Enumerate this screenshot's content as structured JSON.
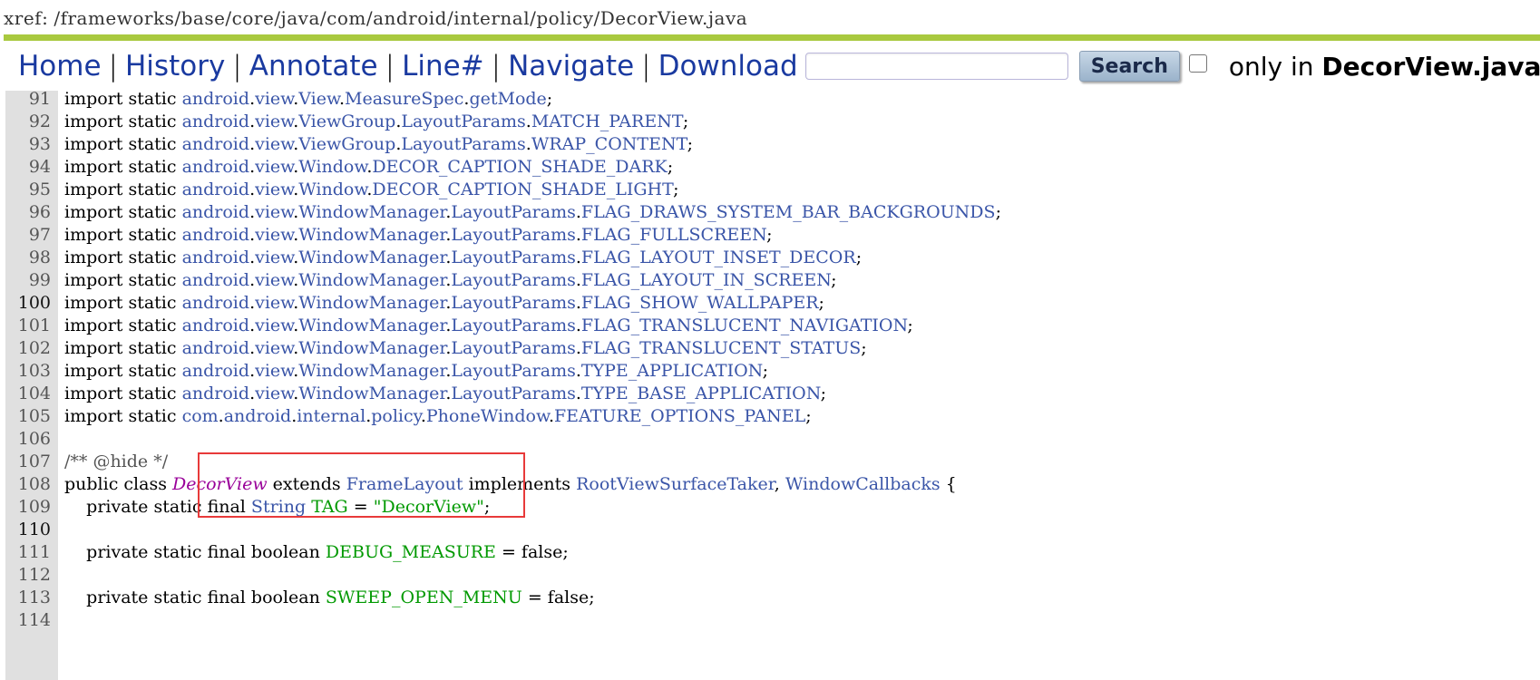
{
  "xref": {
    "label": "xref:",
    "path": "/frameworks/base/core/java/com/android/internal/policy/DecorView.java"
  },
  "nav": {
    "home": "Home",
    "history": "History",
    "annotate": "Annotate",
    "line": "Line#",
    "navigate": "Navigate",
    "download": "Download",
    "separator": "|",
    "search_button": "Search",
    "search_value": "",
    "only_in_prefix": "only in",
    "only_in_file": "DecorView.java"
  },
  "code_lines": [
    {
      "num": "91",
      "tokens": [
        {
          "t": "import static ",
          "c": "kw"
        },
        {
          "t": "android",
          "c": "pkg"
        },
        {
          "t": ".",
          "c": "punct"
        },
        {
          "t": "view",
          "c": "pkg"
        },
        {
          "t": ".",
          "c": "punct"
        },
        {
          "t": "View",
          "c": "cls"
        },
        {
          "t": ".",
          "c": "punct"
        },
        {
          "t": "MeasureSpec",
          "c": "cls"
        },
        {
          "t": ".",
          "c": "punct"
        },
        {
          "t": "getMode",
          "c": "cls"
        },
        {
          "t": ";",
          "c": "punct"
        }
      ]
    },
    {
      "num": "92",
      "tokens": [
        {
          "t": "import static ",
          "c": "kw"
        },
        {
          "t": "android",
          "c": "pkg"
        },
        {
          "t": ".",
          "c": "punct"
        },
        {
          "t": "view",
          "c": "pkg"
        },
        {
          "t": ".",
          "c": "punct"
        },
        {
          "t": "ViewGroup",
          "c": "cls"
        },
        {
          "t": ".",
          "c": "punct"
        },
        {
          "t": "LayoutParams",
          "c": "cls"
        },
        {
          "t": ".",
          "c": "punct"
        },
        {
          "t": "MATCH_PARENT",
          "c": "cls"
        },
        {
          "t": ";",
          "c": "punct"
        }
      ]
    },
    {
      "num": "93",
      "tokens": [
        {
          "t": "import static ",
          "c": "kw"
        },
        {
          "t": "android",
          "c": "pkg"
        },
        {
          "t": ".",
          "c": "punct"
        },
        {
          "t": "view",
          "c": "pkg"
        },
        {
          "t": ".",
          "c": "punct"
        },
        {
          "t": "ViewGroup",
          "c": "cls"
        },
        {
          "t": ".",
          "c": "punct"
        },
        {
          "t": "LayoutParams",
          "c": "cls"
        },
        {
          "t": ".",
          "c": "punct"
        },
        {
          "t": "WRAP_CONTENT",
          "c": "cls"
        },
        {
          "t": ";",
          "c": "punct"
        }
      ]
    },
    {
      "num": "94",
      "tokens": [
        {
          "t": "import static ",
          "c": "kw"
        },
        {
          "t": "android",
          "c": "pkg"
        },
        {
          "t": ".",
          "c": "punct"
        },
        {
          "t": "view",
          "c": "pkg"
        },
        {
          "t": ".",
          "c": "punct"
        },
        {
          "t": "Window",
          "c": "cls"
        },
        {
          "t": ".",
          "c": "punct"
        },
        {
          "t": "DECOR_CAPTION_SHADE_DARK",
          "c": "cls"
        },
        {
          "t": ";",
          "c": "punct"
        }
      ]
    },
    {
      "num": "95",
      "tokens": [
        {
          "t": "import static ",
          "c": "kw"
        },
        {
          "t": "android",
          "c": "pkg"
        },
        {
          "t": ".",
          "c": "punct"
        },
        {
          "t": "view",
          "c": "pkg"
        },
        {
          "t": ".",
          "c": "punct"
        },
        {
          "t": "Window",
          "c": "cls"
        },
        {
          "t": ".",
          "c": "punct"
        },
        {
          "t": "DECOR_CAPTION_SHADE_LIGHT",
          "c": "cls"
        },
        {
          "t": ";",
          "c": "punct"
        }
      ]
    },
    {
      "num": "96",
      "tokens": [
        {
          "t": "import static ",
          "c": "kw"
        },
        {
          "t": "android",
          "c": "pkg"
        },
        {
          "t": ".",
          "c": "punct"
        },
        {
          "t": "view",
          "c": "pkg"
        },
        {
          "t": ".",
          "c": "punct"
        },
        {
          "t": "WindowManager",
          "c": "cls"
        },
        {
          "t": ".",
          "c": "punct"
        },
        {
          "t": "LayoutParams",
          "c": "cls"
        },
        {
          "t": ".",
          "c": "punct"
        },
        {
          "t": "FLAG_DRAWS_SYSTEM_BAR_BACKGROUNDS",
          "c": "cls"
        },
        {
          "t": ";",
          "c": "punct"
        }
      ]
    },
    {
      "num": "97",
      "tokens": [
        {
          "t": "import static ",
          "c": "kw"
        },
        {
          "t": "android",
          "c": "pkg"
        },
        {
          "t": ".",
          "c": "punct"
        },
        {
          "t": "view",
          "c": "pkg"
        },
        {
          "t": ".",
          "c": "punct"
        },
        {
          "t": "WindowManager",
          "c": "cls"
        },
        {
          "t": ".",
          "c": "punct"
        },
        {
          "t": "LayoutParams",
          "c": "cls"
        },
        {
          "t": ".",
          "c": "punct"
        },
        {
          "t": "FLAG_FULLSCREEN",
          "c": "cls"
        },
        {
          "t": ";",
          "c": "punct"
        }
      ]
    },
    {
      "num": "98",
      "tokens": [
        {
          "t": "import static ",
          "c": "kw"
        },
        {
          "t": "android",
          "c": "pkg"
        },
        {
          "t": ".",
          "c": "punct"
        },
        {
          "t": "view",
          "c": "pkg"
        },
        {
          "t": ".",
          "c": "punct"
        },
        {
          "t": "WindowManager",
          "c": "cls"
        },
        {
          "t": ".",
          "c": "punct"
        },
        {
          "t": "LayoutParams",
          "c": "cls"
        },
        {
          "t": ".",
          "c": "punct"
        },
        {
          "t": "FLAG_LAYOUT_INSET_DECOR",
          "c": "cls"
        },
        {
          "t": ";",
          "c": "punct"
        }
      ]
    },
    {
      "num": "99",
      "tokens": [
        {
          "t": "import static ",
          "c": "kw"
        },
        {
          "t": "android",
          "c": "pkg"
        },
        {
          "t": ".",
          "c": "punct"
        },
        {
          "t": "view",
          "c": "pkg"
        },
        {
          "t": ".",
          "c": "punct"
        },
        {
          "t": "WindowManager",
          "c": "cls"
        },
        {
          "t": ".",
          "c": "punct"
        },
        {
          "t": "LayoutParams",
          "c": "cls"
        },
        {
          "t": ".",
          "c": "punct"
        },
        {
          "t": "FLAG_LAYOUT_IN_SCREEN",
          "c": "cls"
        },
        {
          "t": ";",
          "c": "punct"
        }
      ]
    },
    {
      "num": "100",
      "highlight": true,
      "tokens": [
        {
          "t": "import static ",
          "c": "kw"
        },
        {
          "t": "android",
          "c": "pkg"
        },
        {
          "t": ".",
          "c": "punct"
        },
        {
          "t": "view",
          "c": "pkg"
        },
        {
          "t": ".",
          "c": "punct"
        },
        {
          "t": "WindowManager",
          "c": "cls"
        },
        {
          "t": ".",
          "c": "punct"
        },
        {
          "t": "LayoutParams",
          "c": "cls"
        },
        {
          "t": ".",
          "c": "punct"
        },
        {
          "t": "FLAG_SHOW_WALLPAPER",
          "c": "cls"
        },
        {
          "t": ";",
          "c": "punct"
        }
      ]
    },
    {
      "num": "101",
      "tokens": [
        {
          "t": "import static ",
          "c": "kw"
        },
        {
          "t": "android",
          "c": "pkg"
        },
        {
          "t": ".",
          "c": "punct"
        },
        {
          "t": "view",
          "c": "pkg"
        },
        {
          "t": ".",
          "c": "punct"
        },
        {
          "t": "WindowManager",
          "c": "cls"
        },
        {
          "t": ".",
          "c": "punct"
        },
        {
          "t": "LayoutParams",
          "c": "cls"
        },
        {
          "t": ".",
          "c": "punct"
        },
        {
          "t": "FLAG_TRANSLUCENT_NAVIGATION",
          "c": "cls"
        },
        {
          "t": ";",
          "c": "punct"
        }
      ]
    },
    {
      "num": "102",
      "tokens": [
        {
          "t": "import static ",
          "c": "kw"
        },
        {
          "t": "android",
          "c": "pkg"
        },
        {
          "t": ".",
          "c": "punct"
        },
        {
          "t": "view",
          "c": "pkg"
        },
        {
          "t": ".",
          "c": "punct"
        },
        {
          "t": "WindowManager",
          "c": "cls"
        },
        {
          "t": ".",
          "c": "punct"
        },
        {
          "t": "LayoutParams",
          "c": "cls"
        },
        {
          "t": ".",
          "c": "punct"
        },
        {
          "t": "FLAG_TRANSLUCENT_STATUS",
          "c": "cls"
        },
        {
          "t": ";",
          "c": "punct"
        }
      ]
    },
    {
      "num": "103",
      "tokens": [
        {
          "t": "import static ",
          "c": "kw"
        },
        {
          "t": "android",
          "c": "pkg"
        },
        {
          "t": ".",
          "c": "punct"
        },
        {
          "t": "view",
          "c": "pkg"
        },
        {
          "t": ".",
          "c": "punct"
        },
        {
          "t": "WindowManager",
          "c": "cls"
        },
        {
          "t": ".",
          "c": "punct"
        },
        {
          "t": "LayoutParams",
          "c": "cls"
        },
        {
          "t": ".",
          "c": "punct"
        },
        {
          "t": "TYPE_APPLICATION",
          "c": "cls"
        },
        {
          "t": ";",
          "c": "punct"
        }
      ]
    },
    {
      "num": "104",
      "tokens": [
        {
          "t": "import static ",
          "c": "kw"
        },
        {
          "t": "android",
          "c": "pkg"
        },
        {
          "t": ".",
          "c": "punct"
        },
        {
          "t": "view",
          "c": "pkg"
        },
        {
          "t": ".",
          "c": "punct"
        },
        {
          "t": "WindowManager",
          "c": "cls"
        },
        {
          "t": ".",
          "c": "punct"
        },
        {
          "t": "LayoutParams",
          "c": "cls"
        },
        {
          "t": ".",
          "c": "punct"
        },
        {
          "t": "TYPE_BASE_APPLICATION",
          "c": "cls"
        },
        {
          "t": ";",
          "c": "punct"
        }
      ]
    },
    {
      "num": "105",
      "tokens": [
        {
          "t": "import static ",
          "c": "kw"
        },
        {
          "t": "com",
          "c": "pkg"
        },
        {
          "t": ".",
          "c": "punct"
        },
        {
          "t": "android",
          "c": "pkg"
        },
        {
          "t": ".",
          "c": "punct"
        },
        {
          "t": "internal",
          "c": "pkg"
        },
        {
          "t": ".",
          "c": "punct"
        },
        {
          "t": "policy",
          "c": "pkg"
        },
        {
          "t": ".",
          "c": "punct"
        },
        {
          "t": "PhoneWindow",
          "c": "cls"
        },
        {
          "t": ".",
          "c": "punct"
        },
        {
          "t": "FEATURE_OPTIONS_PANEL",
          "c": "cls"
        },
        {
          "t": ";",
          "c": "punct"
        }
      ]
    },
    {
      "num": "106",
      "tokens": []
    },
    {
      "num": "107",
      "tokens": [
        {
          "t": "/** @hide */",
          "c": "cmt"
        }
      ]
    },
    {
      "num": "108",
      "tokens": [
        {
          "t": "public class ",
          "c": "kw"
        },
        {
          "t": "DecorView",
          "c": "type-def"
        },
        {
          "t": " extends ",
          "c": "kw"
        },
        {
          "t": "FrameLayout",
          "c": "cls"
        },
        {
          "t": " implements ",
          "c": "kw"
        },
        {
          "t": "RootViewSurfaceTaker",
          "c": "cls"
        },
        {
          "t": ", ",
          "c": "punct"
        },
        {
          "t": "WindowCallbacks",
          "c": "cls"
        },
        {
          "t": " {",
          "c": "punct"
        }
      ]
    },
    {
      "num": "109",
      "tokens": [
        {
          "t": "    private static final ",
          "c": "kw"
        },
        {
          "t": "String",
          "c": "cls"
        },
        {
          "t": " ",
          "c": "punct"
        },
        {
          "t": "TAG",
          "c": "const"
        },
        {
          "t": " = ",
          "c": "punct"
        },
        {
          "t": "\"DecorView\"",
          "c": "str"
        },
        {
          "t": ";",
          "c": "punct"
        }
      ]
    },
    {
      "num": "110",
      "highlight": true,
      "tokens": []
    },
    {
      "num": "111",
      "tokens": [
        {
          "t": "    private static final boolean ",
          "c": "kw"
        },
        {
          "t": "DEBUG_MEASURE",
          "c": "const"
        },
        {
          "t": " = false;",
          "c": "punct"
        }
      ]
    },
    {
      "num": "112",
      "tokens": []
    },
    {
      "num": "113",
      "tokens": [
        {
          "t": "    private static final boolean ",
          "c": "kw"
        },
        {
          "t": "SWEEP_OPEN_MENU",
          "c": "const"
        },
        {
          "t": " = false;",
          "c": "punct"
        }
      ]
    },
    {
      "num": "114",
      "tokens": []
    }
  ]
}
